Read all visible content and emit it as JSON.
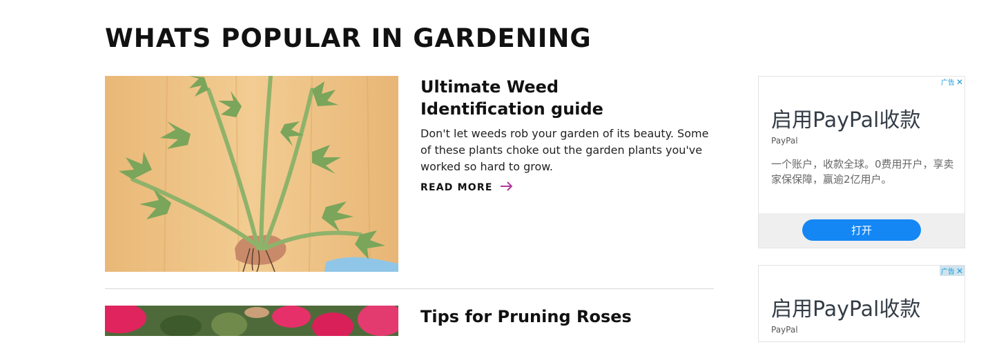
{
  "section": {
    "title": "WHATS POPULAR IN GARDENING"
  },
  "articles": [
    {
      "title": "Ultimate Weed Identification guide",
      "excerpt": "Don't let weeds rob your garden of its beauty. Some of these plants choke out the garden plants you've worked so hard to grow.",
      "read_more": "READ MORE",
      "image": "weed-plant-photo"
    },
    {
      "title": "Tips for Pruning Roses",
      "image": "roses-photo"
    }
  ],
  "ads": [
    {
      "badge": "广告",
      "headline": "启用PayPal收款",
      "advertiser": "PayPal",
      "description": "一个账户，收款全球。0费用开户，享卖家保保障，赢逾2亿用户。",
      "cta": "打开"
    },
    {
      "badge": "广告",
      "headline": "启用PayPal收款",
      "advertiser": "PayPal"
    }
  ],
  "colors": {
    "accent_arrow": "#b0379b",
    "ad_button": "#1487f5",
    "ad_badge": "#1a9bd7"
  },
  "icons": [
    "arrow-right-icon",
    "close-icon"
  ]
}
